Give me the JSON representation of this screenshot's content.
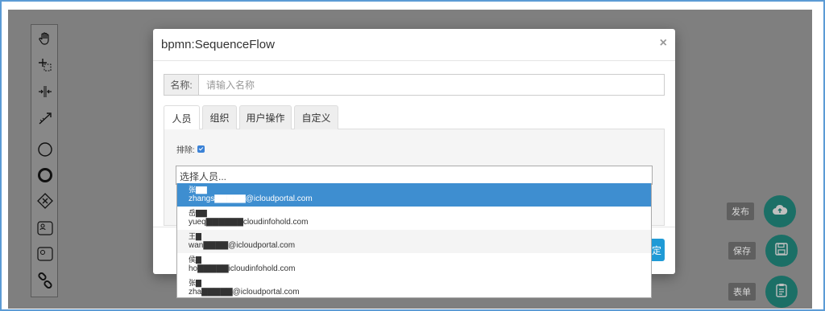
{
  "modal": {
    "title": "bpmn:SequenceFlow",
    "close": "×",
    "name_label": "名称:",
    "name_placeholder": "请输入名称",
    "tabs": [
      {
        "label": "人员",
        "active": true
      },
      {
        "label": "组织",
        "active": false
      },
      {
        "label": "用户操作",
        "active": false
      },
      {
        "label": "自定义",
        "active": false
      }
    ],
    "exclude_label": "排除:",
    "exclude_checked": true,
    "ok_label": "定"
  },
  "select": {
    "placeholder": "选择人员...",
    "options": [
      {
        "name": "张▇▇",
        "email": "zhangs▇▇▇▇▇@icloudportal.com",
        "selected": true
      },
      {
        "name": "岳▇▇",
        "email": "yueq▇▇▇▇▇▇cloudinfohold.com",
        "selected": false
      },
      {
        "name": "王▇",
        "email": "wan▇▇▇▇@icloudportal.com",
        "selected": false
      },
      {
        "name": "侯▇",
        "email": "ho▇▇▇▇▇icloudinfohold.com",
        "selected": false
      },
      {
        "name": "张▇",
        "email": "zha▇▇▇▇▇@icloudportal.com",
        "selected": false
      }
    ]
  },
  "sidebar_actions": [
    {
      "label": "发布",
      "icon": "cloud-upload-icon"
    },
    {
      "label": "保存",
      "icon": "save-icon"
    },
    {
      "label": "表单",
      "icon": "clipboard-icon"
    }
  ],
  "toolbar_icons": [
    "hand-tool-icon",
    "lasso-tool-icon",
    "space-tool-icon",
    "global-connect-icon",
    "start-event-icon",
    "end-event-icon",
    "gateway-icon",
    "user-task-icon",
    "service-task-icon",
    "link-icon"
  ],
  "colors": {
    "fab": "#1b6f66",
    "selected_option": "#3e8ed0",
    "primary_button": "#1f9ad6"
  }
}
